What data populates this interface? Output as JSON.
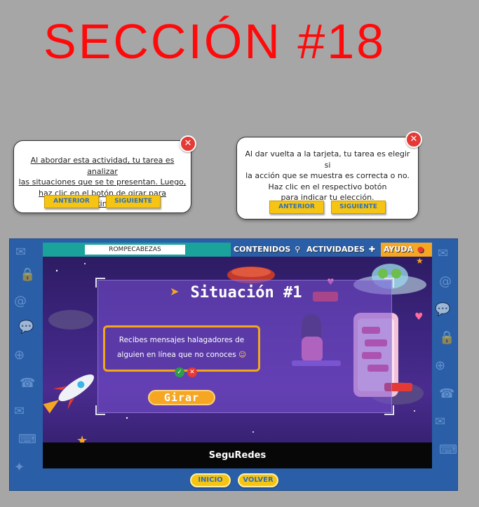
{
  "section_title": "SECCIÓN #18",
  "tooltip_left": {
    "lines": [
      "Al abordar esta actividad, tu tarea es analizar",
      "las situaciones que se te presentan. Luego,",
      "haz clic en el botón de girar para continuar."
    ],
    "prev_label": "ANTERIOR",
    "next_label": "SIGUIENTE"
  },
  "tooltip_right": {
    "lines": [
      "Al dar vuelta a la tarjeta, tu tarea es elegir si",
      "la acción que se muestra es correcta o no.",
      "Haz clic en el respectivo botón",
      "para indicar tu elección."
    ],
    "prev_label": "ANTERIOR",
    "next_label": "SIGUIENTE"
  },
  "app": {
    "search_value": "ROMPECABEZAS",
    "menu": {
      "contents": "CONTENIDOS",
      "activities": "ACTIVIDADES",
      "help": "AYUDA"
    },
    "situation_title": "Situación #1",
    "question": "Recibes mensajes halagadores de alguien en línea que no conoces",
    "flip_button": "Girar",
    "brand": "SeguRedes",
    "nav": {
      "home": "INICIO",
      "back": "VOLVER"
    }
  },
  "colors": {
    "title_red": "#ff0a0a",
    "accent_yellow": "#f6c514",
    "button_text_blue": "#2f6fb8",
    "frame_blue": "#2a5fa8",
    "topbar_teal": "#1aa39a",
    "close_red": "#e53935"
  }
}
